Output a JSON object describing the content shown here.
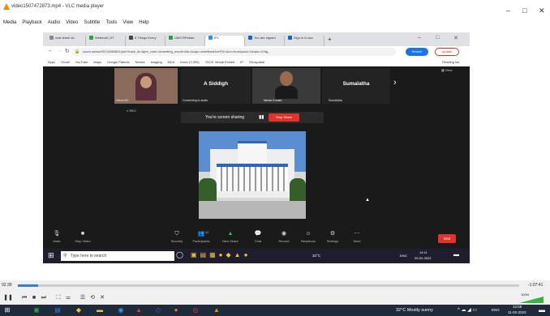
{
  "window": {
    "title": "video1507472873.mp4 - VLC media player",
    "menu": [
      "Media",
      "Playback",
      "Audio",
      "Video",
      "Subtitle",
      "Tools",
      "View",
      "Help"
    ]
  },
  "browser": {
    "tabs": [
      "mail sheet &c",
      "Webmail | IIT",
      "6 Things Every",
      "UMS RPalare",
      "IPL",
      "You are signed",
      "Sign in to acc"
    ],
    "url": "zoom.us/wc/95710584651/join?track_id=&jmf_code=&meeting_result=&tk=&cap=undefined&refTrf=&un=true&pwd=1&wpk=Chfg...",
    "recent": "Recent",
    "update": "Update",
    "bookmarks": [
      "Apps",
      "Gmail",
      "YouTube",
      "Maps",
      "Google Patents",
      "Nestra",
      "Imaging",
      "NDA",
      "Inbox (3,905)",
      "YKCE Virtual Exhibit",
      "IP",
      "Geospatial"
    ],
    "reading_list": "Reading list"
  },
  "zoom": {
    "participants": [
      {
        "name": "",
        "sub": "Hema M3"
      },
      {
        "name": "A Siddigh",
        "sub": "Connecting to audio"
      },
      {
        "name": "",
        "sub": "Nanda Kumari"
      },
      {
        "name": "Sumalatha",
        "sub": "Sumalatha"
      }
    ],
    "view_label": "View",
    "rec_label": "REC",
    "sharing_text": "You're screen sharing",
    "stop_share": "Stop Share",
    "controls": [
      "Mute",
      "Stop Video",
      "Security",
      "Participants",
      "New Share",
      "Chat",
      "Record",
      "Reactions",
      "Settings",
      "More"
    ],
    "participant_count": "42",
    "end": "End"
  },
  "inner_taskbar": {
    "search_placeholder": "Type here to search",
    "weather": "32°C",
    "lang": "ENG",
    "time": "14:11",
    "date": "09-02-2022"
  },
  "player": {
    "elapsed": "02:39",
    "remaining": "-1:07:41",
    "progress": 0.04,
    "volume": "100%"
  },
  "taskbar": {
    "weather": "32°C  Mostly sunny",
    "lang": "ENG",
    "time": "12:58",
    "date": "11-02-2022"
  }
}
